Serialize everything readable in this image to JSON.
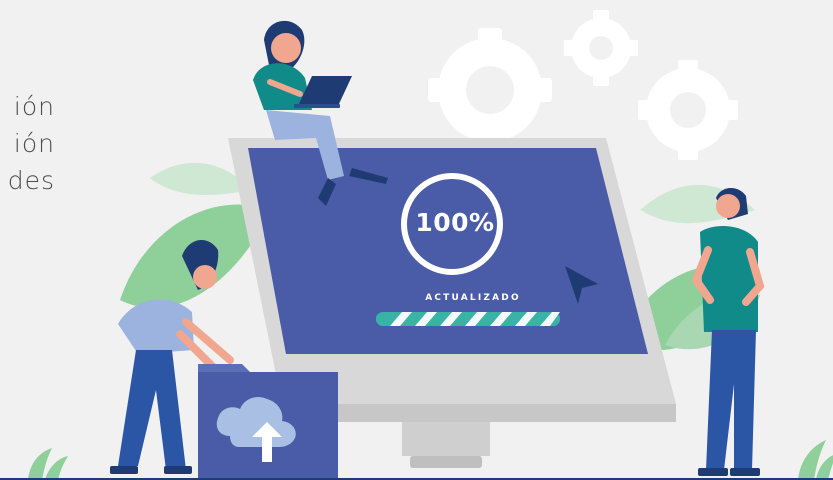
{
  "left_text": {
    "lines": [
      "ión",
      "ión",
      "des"
    ]
  },
  "screen": {
    "percent_label": "100%",
    "status_label": "ACTUALIZADO",
    "progress": 1.0
  },
  "colors": {
    "background": "#f1f1f1",
    "screen": "#4a5ba8",
    "monitor_frame": "#c9c9c9",
    "leaf_green": "#8fcf9a",
    "teal": "#118a8a",
    "navy": "#1f3b73",
    "folder_blue": "#5a6fb8"
  },
  "icons": [
    "gear-icon",
    "cursor-icon",
    "cloud-upload-icon",
    "laptop-icon"
  ]
}
